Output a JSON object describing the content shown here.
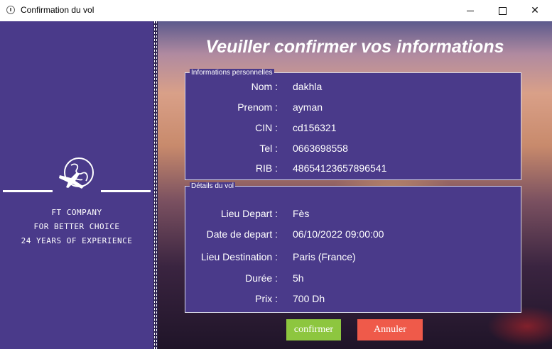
{
  "window": {
    "title": "Confirmation du vol",
    "app_icon": "info-icon",
    "controls": [
      "minimize-icon",
      "maximize-icon",
      "close-icon"
    ]
  },
  "sidebar": {
    "logo_icon": "globe-airplane-icon",
    "company": "FT COMPANY",
    "slogan": "FOR BETTER CHOICE",
    "experience": "24 YEARS OF EXPERIENCE",
    "background_color": "#4a3a8a"
  },
  "main": {
    "heading": "Veuiller confirmer vos informations",
    "personal": {
      "legend": "Informations personnelles",
      "fields": [
        {
          "label": "Nom :",
          "value": "dakhla"
        },
        {
          "label": "Prenom :",
          "value": "ayman"
        },
        {
          "label": "CIN :",
          "value": "cd156321"
        },
        {
          "label": "Tel :",
          "value": "0663698558"
        },
        {
          "label": "RIB :",
          "value": "48654123657896541"
        }
      ]
    },
    "flight": {
      "legend": "Détails du vol",
      "fields": [
        {
          "label": "Lieu Depart :",
          "value": "Fès"
        },
        {
          "label": "Date de depart :",
          "value": "06/10/2022 09:00:00"
        },
        {
          "label": "Lieu Destination :",
          "value": "Paris (France)"
        },
        {
          "label": "Durée :",
          "value": "5h"
        },
        {
          "label": "Prix :",
          "value": "700 Dh"
        }
      ]
    },
    "buttons": {
      "confirm": "confirmer",
      "cancel": "Annuler"
    }
  },
  "colors": {
    "panel": "#4a3a8a",
    "confirm": "#8dc63f",
    "cancel": "#ef5a4a"
  }
}
